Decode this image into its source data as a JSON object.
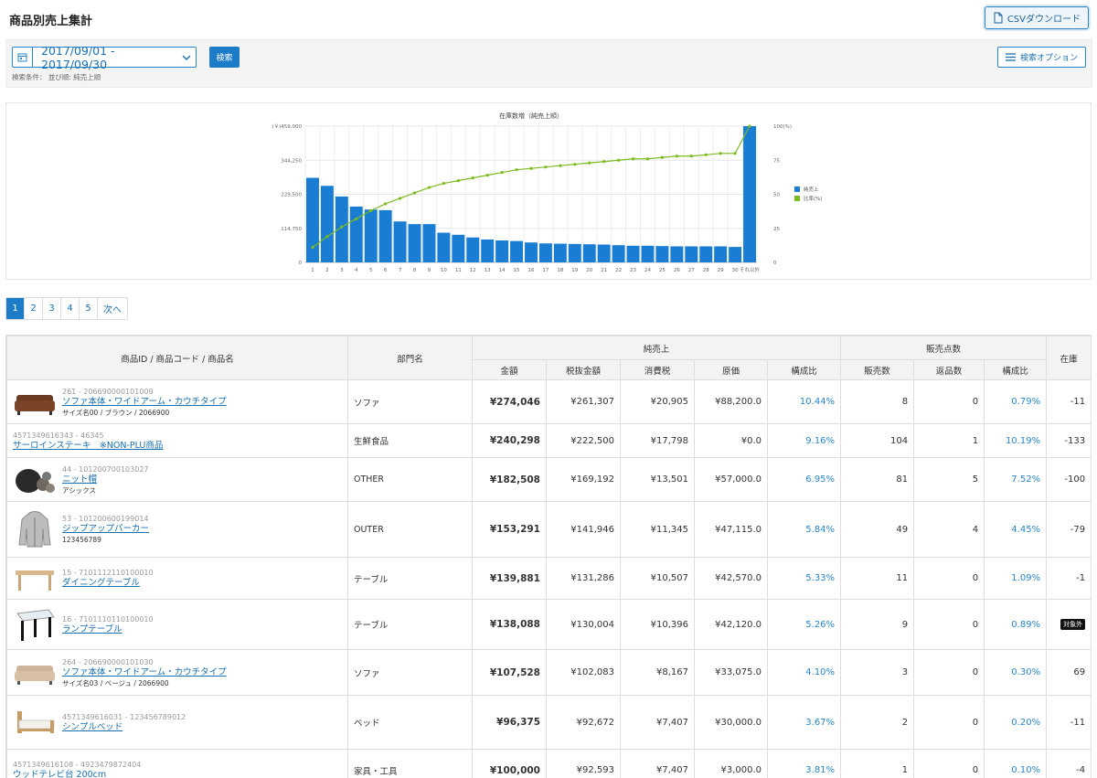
{
  "header": {
    "title": "商品別売上集計",
    "csv_label": "CSVダウンロード"
  },
  "search": {
    "date_range": "2017/09/01 - 2017/09/30",
    "search_label": "検索",
    "conditions": "検索条件： 並び順: 純売上順",
    "options_label": "検索オプション"
  },
  "chart_data": {
    "type": "bar",
    "title": "在庫数増（純売上順）",
    "categories": [
      "1",
      "2",
      "3",
      "4",
      "5",
      "6",
      "7",
      "8",
      "9",
      "10",
      "11",
      "12",
      "13",
      "14",
      "15",
      "16",
      "17",
      "18",
      "19",
      "20",
      "21",
      "22",
      "23",
      "24",
      "25",
      "26",
      "27",
      "28",
      "29",
      "30",
      "それ以外"
    ],
    "series": [
      {
        "name": "純売上",
        "values": [
          285000,
          258000,
          222000,
          188000,
          178000,
          176000,
          138000,
          129000,
          129000,
          100000,
          93000,
          84000,
          77000,
          74000,
          72000,
          67000,
          64000,
          63000,
          62000,
          61000,
          60000,
          58000,
          56000,
          56000,
          55000,
          54000,
          54000,
          54000,
          54000,
          52000,
          1459000
        ]
      },
      {
        "name": "比率(%)",
        "values": [
          11,
          19,
          26,
          32,
          38,
          43,
          47,
          51,
          55,
          58,
          60,
          62,
          64,
          66,
          68,
          69,
          70,
          71,
          72,
          73,
          74,
          75,
          76,
          76,
          77,
          78,
          78,
          79,
          80,
          80,
          100
        ]
      }
    ],
    "y_ticks": [
      "(￥)459,000",
      "344,250",
      "229,500",
      "114,750",
      "0"
    ],
    "y2_ticks": [
      "100(%)",
      "75",
      "50",
      "25",
      "0"
    ],
    "ylim": [
      0,
      459000
    ],
    "y2lim": [
      0,
      100
    ],
    "legend_position": "right",
    "colors": {
      "bar": "#1a7dd4",
      "line": "#7cbb1e"
    }
  },
  "pager": {
    "pages": [
      "1",
      "2",
      "3",
      "4",
      "5"
    ],
    "next": "次へ",
    "active": "1"
  },
  "table": {
    "headers": {
      "product": "商品ID / 商品コード / 商品名",
      "dept": "部門名",
      "net_sales": "純売上",
      "sales_qty": "販売点数",
      "stock": "在庫",
      "amount": "金額",
      "tax_excl": "税抜金額",
      "tax": "消費税",
      "cost": "原価",
      "ratio": "構成比",
      "sold": "販売数",
      "returned": "返品数",
      "qty_ratio": "構成比"
    },
    "rows": [
      {
        "meta": "261 - 206690000101009",
        "name": "ソファ本体・ワイドアーム・カウチタイプ",
        "sub": "サイズ名00 / ブラウン / 2066900",
        "icon": "sofa-brown",
        "dept": "ソファ",
        "amount": "¥274,046",
        "tax_excl": "¥261,307",
        "tax": "¥20,905",
        "cost": "¥88,200.0",
        "ratio": "10.44%",
        "sold": "8",
        "returned": "0",
        "qty_ratio": "0.79%",
        "stock": "-11"
      },
      {
        "meta": "4571349616343 - 46345",
        "name": "サーロインステーキ　※NON-PLU商品",
        "sub": "",
        "icon": "",
        "dept": "生鮮食品",
        "amount": "¥240,298",
        "tax_excl": "¥222,500",
        "tax": "¥17,798",
        "cost": "¥0.0",
        "ratio": "9.16%",
        "sold": "104",
        "returned": "1",
        "qty_ratio": "10.19%",
        "stock": "-133"
      },
      {
        "meta": "44 - 101200700103027",
        "name": "ニット帽",
        "sub": "アシックス",
        "icon": "knit-cap",
        "dept": "OTHER",
        "amount": "¥182,508",
        "tax_excl": "¥169,192",
        "tax": "¥13,501",
        "cost": "¥57,000.0",
        "ratio": "6.95%",
        "sold": "81",
        "returned": "5",
        "qty_ratio": "7.52%",
        "stock": "-100"
      },
      {
        "meta": "53 - 101200600199014",
        "name": "ジップアップパーカー",
        "sub": "123456789",
        "icon": "hoodie",
        "dept": "OUTER",
        "amount": "¥153,291",
        "tax_excl": "¥141,946",
        "tax": "¥11,345",
        "cost": "¥47,115.0",
        "ratio": "5.84%",
        "sold": "49",
        "returned": "4",
        "qty_ratio": "4.45%",
        "stock": "-79"
      },
      {
        "meta": "15 - 7101112110100010",
        "name": "ダイニングテーブル",
        "sub": "",
        "icon": "dining-table",
        "dept": "テーブル",
        "amount": "¥139,881",
        "tax_excl": "¥131,286",
        "tax": "¥10,507",
        "cost": "¥42,570.0",
        "ratio": "5.33%",
        "sold": "11",
        "returned": "0",
        "qty_ratio": "1.09%",
        "stock": "-1"
      },
      {
        "meta": "16 - 7101110110100010",
        "name": "ランプテーブル",
        "sub": "",
        "icon": "lamp-table",
        "dept": "テーブル",
        "amount": "¥138,088",
        "tax_excl": "¥130,004",
        "tax": "¥10,396",
        "cost": "¥42,120.0",
        "ratio": "5.26%",
        "sold": "9",
        "returned": "0",
        "qty_ratio": "0.89%",
        "stock": "",
        "badge": "対象外"
      },
      {
        "meta": "264 - 206690000101030",
        "name": "ソファ本体・ワイドアーム・カウチタイプ",
        "sub": "サイズ名03 / ベージュ / 2066900",
        "icon": "sofa-beige",
        "dept": "ソファ",
        "amount": "¥107,528",
        "tax_excl": "¥102,083",
        "tax": "¥8,167",
        "cost": "¥33,075.0",
        "ratio": "4.10%",
        "sold": "3",
        "returned": "0",
        "qty_ratio": "0.30%",
        "stock": "69"
      },
      {
        "meta": "4571349616031 - 123456789012",
        "name": "シンプルベッド",
        "sub": "",
        "icon": "bed",
        "dept": "ベッド",
        "amount": "¥96,375",
        "tax_excl": "¥92,672",
        "tax": "¥7,407",
        "cost": "¥30,000.0",
        "ratio": "3.67%",
        "sold": "2",
        "returned": "0",
        "qty_ratio": "0.20%",
        "stock": "-11"
      },
      {
        "meta": "4571349616108 - 4923479872404",
        "name": "ウッドテレビ台 200cm",
        "sub": "",
        "icon": "",
        "dept": "家具・工具",
        "amount": "¥100,000",
        "tax_excl": "¥92,593",
        "tax": "¥7,407",
        "cost": "¥3,000.0",
        "ratio": "3.81%",
        "sold": "1",
        "returned": "0",
        "qty_ratio": "0.10%",
        "stock": "-4"
      }
    ]
  }
}
